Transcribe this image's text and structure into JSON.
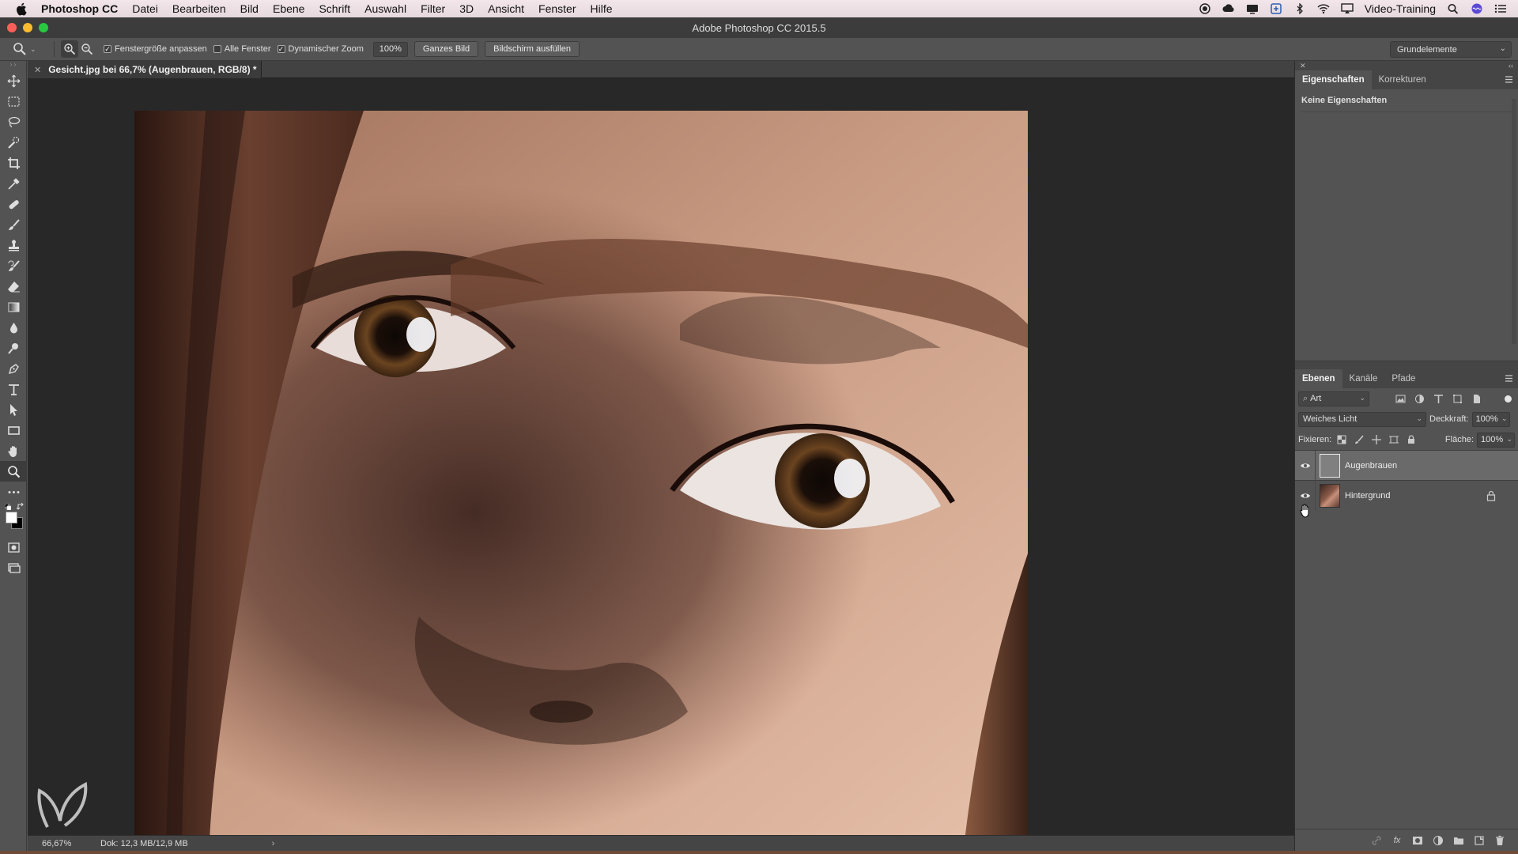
{
  "menubar": {
    "app_name": "Photoshop CC",
    "items": [
      "Datei",
      "Bearbeiten",
      "Bild",
      "Ebene",
      "Schrift",
      "Auswahl",
      "Filter",
      "3D",
      "Ansicht",
      "Fenster",
      "Hilfe"
    ],
    "user": "Video-Training"
  },
  "window": {
    "title": "Adobe Photoshop CC 2015.5"
  },
  "options": {
    "fit_window_label": "Fenstergröße anpassen",
    "all_windows_label": "Alle Fenster",
    "dynamic_zoom_label": "Dynamischer Zoom",
    "zoom_value": "100%",
    "fit_screen_button": "Ganzes Bild",
    "fill_screen_button": "Bildschirm ausfüllen",
    "workspace": "Grundelemente"
  },
  "document": {
    "tab_title": "Gesicht.jpg bei 66,7% (Augenbrauen, RGB/8) *",
    "zoom": "66,67%",
    "doc_size": "Dok: 12,3 MB/12,9 MB"
  },
  "properties_panel": {
    "tabs": [
      "Eigenschaften",
      "Korrekturen"
    ],
    "empty_text": "Keine Eigenschaften"
  },
  "layers_panel": {
    "tabs": [
      "Ebenen",
      "Kanäle",
      "Pfade"
    ],
    "filter_label": "Art",
    "blend_mode": "Weiches Licht",
    "opacity_label": "Deckkraft:",
    "opacity_value": "100%",
    "lock_label": "Fixieren:",
    "fill_label": "Fläche:",
    "fill_value": "100%",
    "layers": [
      {
        "name": "Augenbrauen"
      },
      {
        "name": "Hintergrund"
      }
    ]
  },
  "colors": {
    "foreground": "#ffffff",
    "background": "#000000",
    "accent_close": "#fc5f57",
    "accent_minimize": "#fdbc2e",
    "accent_maximize": "#28c840"
  },
  "icons": [
    "apple-icon",
    "zoom-tool-icon",
    "zoom-in-icon",
    "zoom-out-icon",
    "move-tool-icon",
    "marquee-tool-icon",
    "lasso-tool-icon",
    "quick-selection-icon",
    "crop-tool-icon",
    "eyedropper-icon",
    "healing-brush-icon",
    "brush-tool-icon",
    "stamp-tool-icon",
    "history-brush-icon",
    "eraser-icon",
    "gradient-icon",
    "blur-icon",
    "dodge-icon",
    "pen-tool-icon",
    "type-tool-icon",
    "path-selection-icon",
    "rectangle-tool-icon",
    "hand-tool-icon",
    "eye-icon",
    "lock-icon"
  ]
}
